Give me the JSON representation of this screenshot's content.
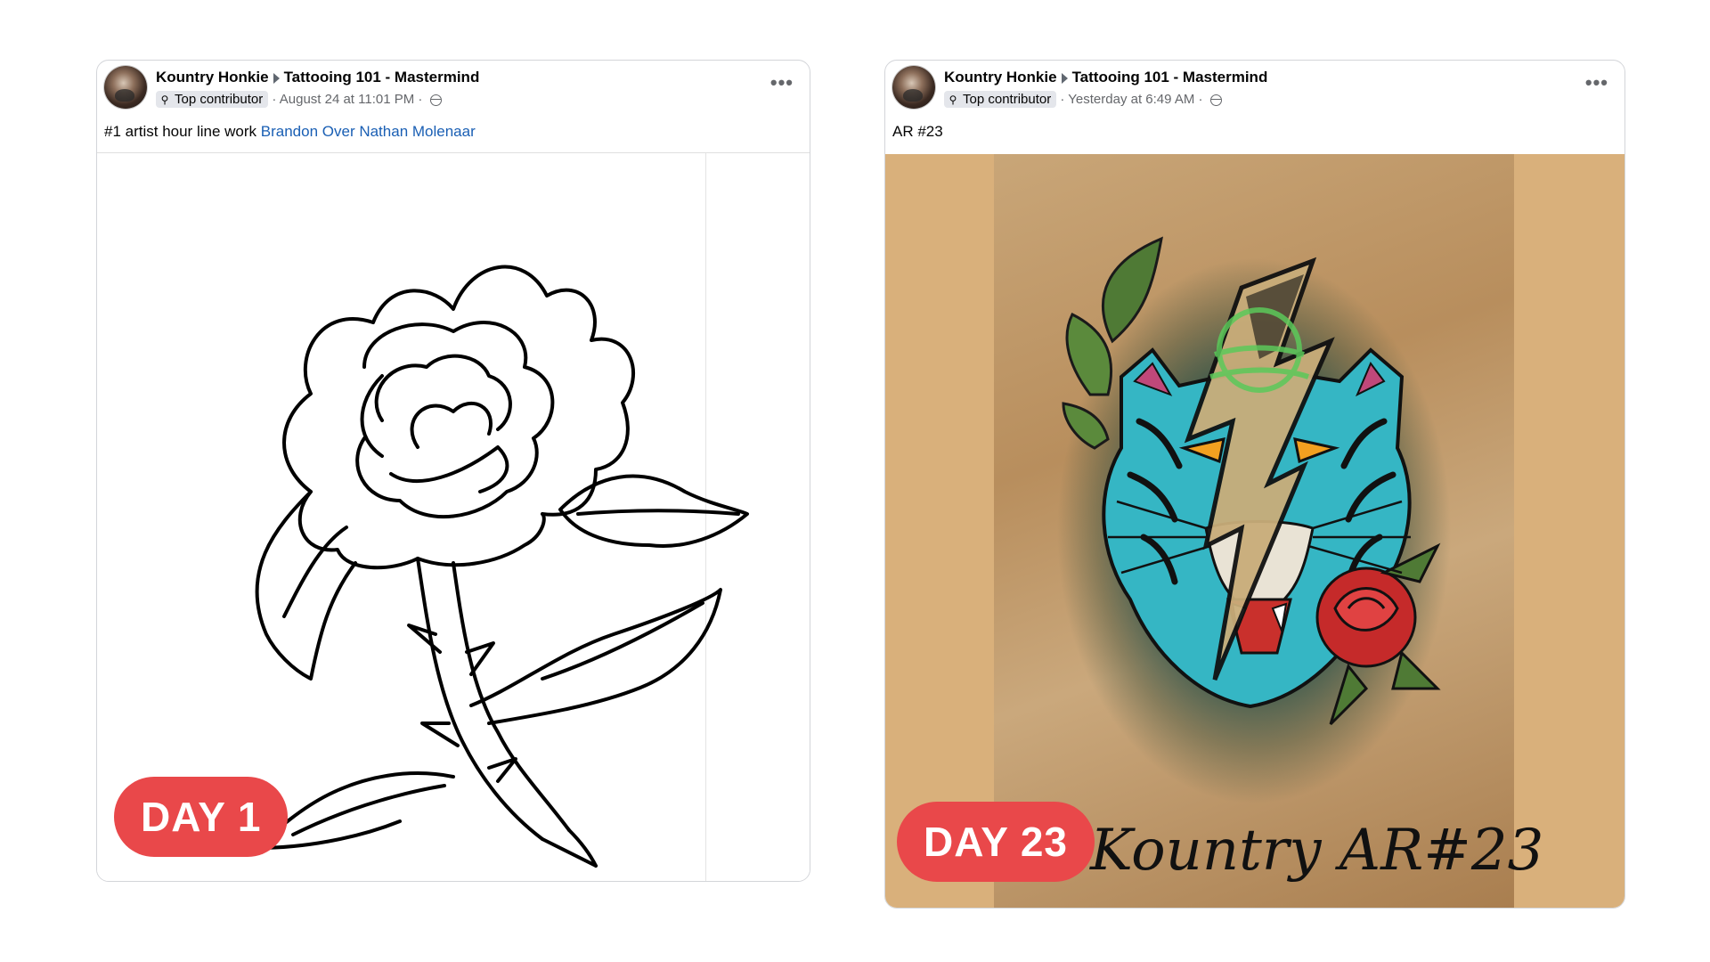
{
  "posts": [
    {
      "author": "Kountry Honkie",
      "group": "Tattooing 101 - Mastermind",
      "badge": "Top contributor",
      "time": "August 24 at 11:01 PM",
      "text": "#1 artist hour line work",
      "mention": "Brandon Over Nathan Molenaar",
      "more": "•••"
    },
    {
      "author": "Kountry Honkie",
      "group": "Tattooing 101 - Mastermind",
      "badge": "Top contributor",
      "time": "Yesterday at 6:49 AM",
      "text": "AR #23",
      "more": "•••"
    }
  ],
  "artwork2_signature": "Kountry AR#23",
  "day_badges": [
    "DAY 1",
    "DAY 23"
  ],
  "colors": {
    "badge_red": "#e9484a",
    "mention_blue": "#1a5fb4",
    "backdrop_tan": "#d9b07b"
  },
  "icons": [
    "ellipsis-icon",
    "top-contributor-icon",
    "globe-icon",
    "caret-right-icon"
  ]
}
